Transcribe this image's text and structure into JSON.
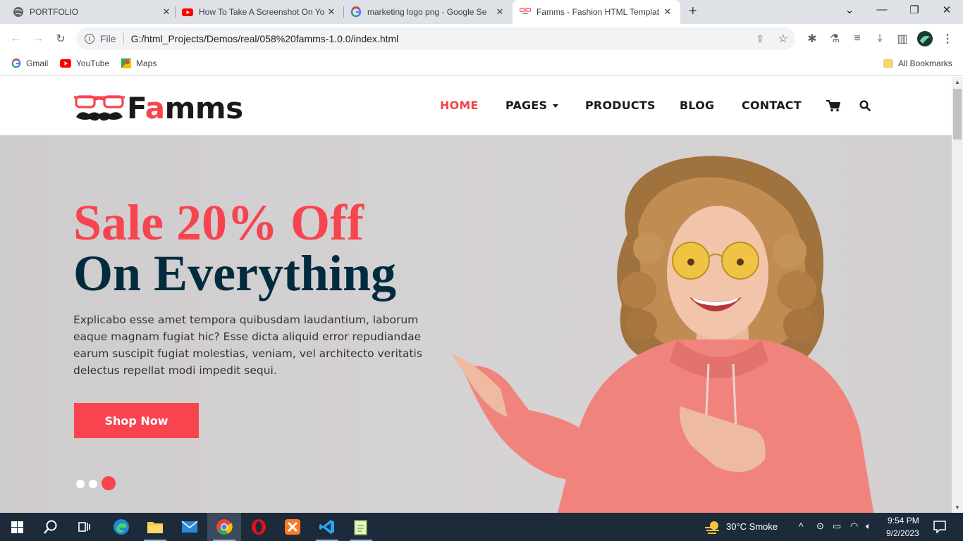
{
  "browser": {
    "tabs": [
      {
        "title": "PORTFOLIO",
        "icon": "globe-icon"
      },
      {
        "title": "How To Take A Screenshot On Yo",
        "icon": "youtube-icon"
      },
      {
        "title": "marketing logo png - Google Se",
        "icon": "google-icon"
      },
      {
        "title": "Famms - Fashion HTML Templat",
        "icon": "famms-favicon",
        "active": true
      }
    ],
    "address": {
      "scheme_label": "File",
      "url": "G:/html_Projects/Demos/real/058%20famms-1.0.0/index.html"
    },
    "bookmarks": [
      {
        "label": "Gmail",
        "icon": "google-icon"
      },
      {
        "label": "YouTube",
        "icon": "youtube-icon"
      },
      {
        "label": "Maps",
        "icon": "maps-icon"
      }
    ],
    "all_bookmarks_label": "All Bookmarks"
  },
  "site": {
    "logo_prefix": "F",
    "logo_accent": "a",
    "logo_suffix": "mms",
    "nav": {
      "home": "HOME",
      "pages": "PAGES",
      "products": "PRODUCTS",
      "blog": "BLOG",
      "contact": "CONTACT"
    },
    "hero": {
      "title_line1": "Sale 20% Off",
      "title_line2": "On Everything",
      "description": "Explicabo esse amet tempora quibusdam laudantium, laborum eaque magnam fugiat hic? Esse dicta aliquid error repudiandae earum suscipit fugiat molestias, veniam, vel architecto veritatis delectus repellat modi impedit sequi.",
      "cta": "Shop Now",
      "slides": 3,
      "active_slide": 3
    },
    "colors": {
      "accent": "#f7444e",
      "dark": "#002c3e"
    }
  },
  "taskbar": {
    "weather": "30°C  Smoke",
    "time": "9:54 PM",
    "date": "9/2/2023"
  }
}
